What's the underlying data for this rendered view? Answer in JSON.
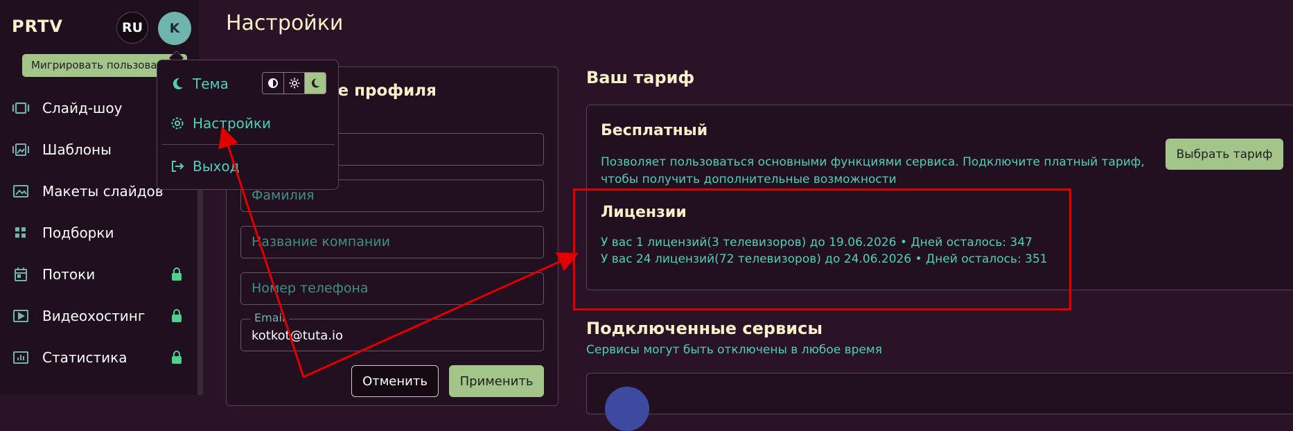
{
  "app": {
    "brand": "PRTV",
    "page_title": "Настройки"
  },
  "header": {
    "lang": "RU",
    "avatar_letter": "K"
  },
  "banner": {
    "migrate_label": "Мигрировать пользователя"
  },
  "sidebar": {
    "items": [
      {
        "label": "Слайд-шоу",
        "icon": "slideshow-icon",
        "locked": false
      },
      {
        "label": "Шаблоны",
        "icon": "templates-icon",
        "locked": false
      },
      {
        "label": "Макеты слайдов",
        "icon": "image-icon",
        "locked": false
      },
      {
        "label": "Подборки",
        "icon": "grid-icon",
        "locked": false
      },
      {
        "label": "Потоки",
        "icon": "calendar-icon",
        "locked": true
      },
      {
        "label": "Видеохостинг",
        "icon": "video-icon",
        "locked": true
      },
      {
        "label": "Статистика",
        "icon": "chart-icon",
        "locked": true
      }
    ]
  },
  "menu": {
    "theme_label": "Тема",
    "settings_label": "Настройки",
    "logout_label": "Выход",
    "theme_options": [
      "auto",
      "light",
      "dark"
    ],
    "theme_selected": "dark"
  },
  "profile": {
    "heading": "ание профиля",
    "fields": {
      "lastname_placeholder": "Фамилия",
      "company_placeholder": "Название компании",
      "phone_placeholder": "Номер телефона",
      "email_label": "Email",
      "email_value": "kotkot@tuta.io"
    },
    "cancel_label": "Отменить",
    "apply_label": "Применить"
  },
  "tariff": {
    "heading": "Ваш тариф",
    "plan_name": "Бесплатный",
    "plan_desc": "Позволяет пользоваться основными функциями сервиса. Подключите платный тариф, чтобы получить дополнительные возможности",
    "choose_label": "Выбрать тариф",
    "licenses_heading": "Лицензии",
    "licenses": [
      "У вас 1 лицензий(3 телевизоров) до 19.06.2026 • Дней осталось: 347",
      "У вас 24 лицензий(72 телевизоров) до 24.06.2026 • Дней осталось: 351"
    ]
  },
  "services": {
    "heading": "Подключенные сервисы",
    "subtitle": "Сервисы могут быть отключены в любое время"
  },
  "colors": {
    "background": "#2a1326",
    "sidebar": "#200f1e",
    "accent_green": "#a3c58a",
    "teal_text": "#4fd0b8",
    "heading_cream": "#f7f0c8",
    "annotation_red": "#e00000"
  }
}
